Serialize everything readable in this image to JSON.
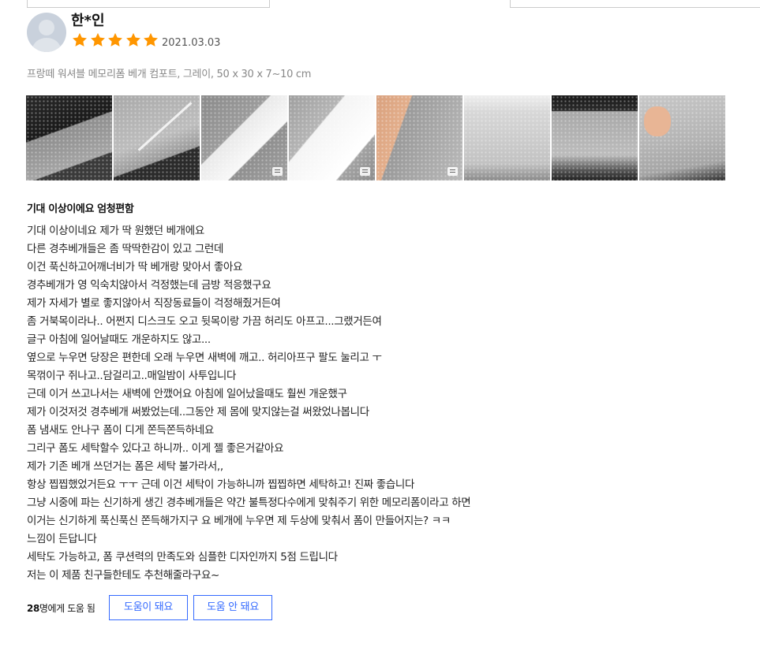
{
  "review": {
    "username": "한*인",
    "rating": 5,
    "date": "2021.03.03",
    "option": "프랑떼 워셔블 메모리폼 베개 컴포트, 그레이, 50 x 30 x 7~10 cm",
    "headline": "기대 이상이에요 엄청편함",
    "content_lines": [
      "기대 이상이네요 제가 딱 원했던 베개에요",
      "다른 경추베개들은 좀 딱딱한감이 있고 그런데",
      "이건 푹신하고어깨너비가 딱 베개랑 맞아서 좋아요",
      "경추베개가 영 익숙치않아서 걱정했는데 금방 적응했구요",
      "제가 자세가 별로 좋지않아서 직장동료들이 걱정해줬거든여",
      "좀 거북목이라나.. 어쩐지 디스크도 오고 뒷목이랑 가끔 허리도 아프고...그랬거든여",
      "글구 아침에 일어날때도 개운하지도 않고...",
      "옆으로 누우면 당장은 편한데 오래 누우면 새벽에 깨고.. 허리아프구 팔도 눌리고 ㅜ",
      "목꺾이구 쥐나고..담걸리고..매일밤이 사투입니다",
      "근데 이거 쓰고나서는 새벽에 안깼어요 아침에 일어났을때도 훨씬 개운했구",
      "제가 이것저것 경추베개 써봤었는데..그동안 제 몸에 맞지않는걸 써왔었나봅니다",
      "폼 냄새도 안나구 폼이 디게 쫀득쫀득하네요",
      "그리구 폼도 세탁할수 있다고 하니까.. 이게 젤 좋은거같아요",
      "제가 기존 베개 쓰던거는 폼은 세탁 불가라서,,",
      "항상 찝찝했었거든요 ㅜㅜ 근데 이건 세탁이 가능하니까 찝찝하면 세탁하고! 진짜 좋습니다",
      "그냥 시중에 파는 신기하게 생긴 경추베개들은 약간 불특정다수에게 맞춰주기 위한 메모리폼이라고 하면",
      "이거는 신기하게 푹신푹신 쫀득해가지구 요 베개에 누우면 제 두상에 맞춰서 폼이 만들어지는? ㅋㅋ",
      "느낌이 든답니다",
      "세탁도 가능하고, 폼 쿠션력의 만족도와 심플한 디자인까지 5점 드립니다",
      "저는 이 제품 친구들한테도 추천해줄라구요~"
    ],
    "helpful_count": "28",
    "helpful_suffix": "명에게 도움 됨",
    "btn_helpful": "도움이 돼요",
    "btn_not_helpful": "도움 안 돼요",
    "photo_count": 8
  },
  "colors": {
    "star": "#ff9600",
    "accent": "#346aff",
    "option_text": "#888888"
  },
  "icons": {
    "star": "star-icon",
    "photo_badge": "image-list-icon"
  }
}
